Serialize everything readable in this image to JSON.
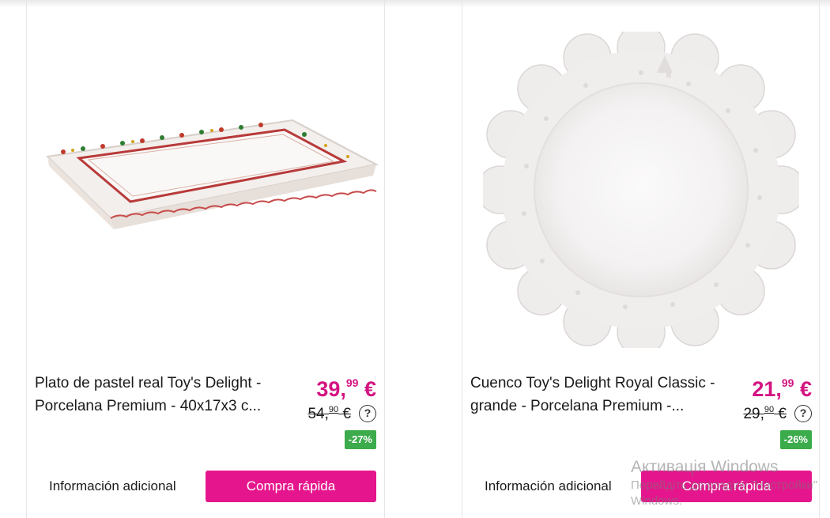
{
  "products": [
    {
      "title": "Plato de pastel real Toy's Delight - Porcelana Premium - 40x17x3 c...",
      "price_int": "39,",
      "price_dec": "99",
      "currency": " €",
      "old_int": "54,",
      "old_dec": "90",
      "old_currency": " €",
      "help": "?",
      "discount": "-27%",
      "info_label": "Información adicional",
      "buy_label": "Compra rápida",
      "image_icon": "rectangular-cake-plate-image"
    },
    {
      "title": "Cuenco Toy's Delight Royal Classic - grande - Porcelana Premium -...",
      "price_int": "21,",
      "price_dec": "99",
      "currency": " €",
      "old_int": "29,",
      "old_dec": "90",
      "old_currency": " €",
      "help": "?",
      "discount": "-26%",
      "info_label": "Información adicional",
      "buy_label": "Compra rápida",
      "image_icon": "round-scalloped-bowl-image"
    }
  ],
  "watermark": {
    "line1": "Активація Windows",
    "line2": "Перейдіть до розділу \"Настройки\"",
    "line3": "Windows."
  },
  "colors": {
    "accent": "#e5168d",
    "price": "#d31481",
    "discount": "#3cab4b"
  }
}
